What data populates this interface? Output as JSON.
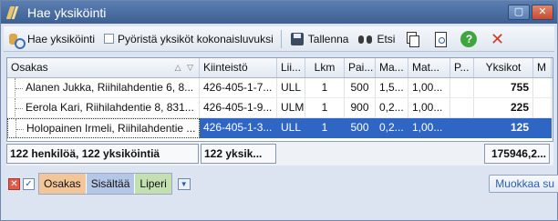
{
  "window": {
    "title": "Hae yksiköinti"
  },
  "toolbar": {
    "search_label": "Hae yksiköinti",
    "round_label": "Pyöristä yksiköt kokonaisluvuksi",
    "save_label": "Tallenna",
    "find_label": "Etsi"
  },
  "columns": [
    "Osakas",
    "Kiinteistö",
    "Lii...",
    "Lkm",
    "Pai...",
    "Ma...",
    "Mat...",
    "P...",
    "Yksikot",
    "M"
  ],
  "rows": [
    {
      "name": "Alanen Jukka, Riihilahdentie 6, 8...",
      "kiint": "426-405-1-7...",
      "lii": "ULL",
      "lkm": "1",
      "pai": "500",
      "ma": "1,5...",
      "mat": "1,00...",
      "p": "",
      "yks": "755"
    },
    {
      "name": "Eerola Kari, Riihilahdentie 8, 831...",
      "kiint": "426-405-1-9...",
      "lii": "ULM",
      "lkm": "1",
      "pai": "900",
      "ma": "0,2...",
      "mat": "1,00...",
      "p": "",
      "yks": "225"
    },
    {
      "name": "Holopainen Irmeli, Riihilahdentie ...",
      "kiint": "426-405-1-3...",
      "lii": "ULL",
      "lkm": "1",
      "pai": "500",
      "ma": "0,2...",
      "mat": "1,00...",
      "p": "",
      "yks": "125"
    }
  ],
  "summary": {
    "persons": "122 henkilöä, 122 yksiköintiä",
    "units": "122 yksik...",
    "total": "175946,2..."
  },
  "groups": [
    "Osakas",
    "Sisältää",
    "Liperi"
  ],
  "edit_label": "Muokkaa su"
}
